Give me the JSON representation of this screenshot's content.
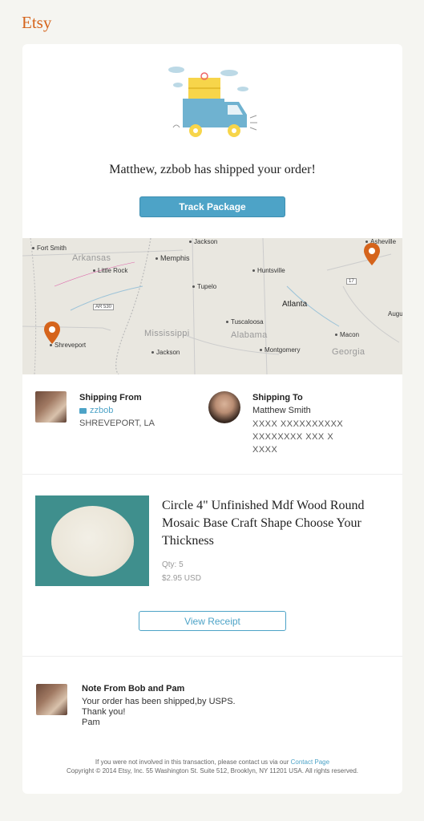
{
  "brand": {
    "logo": "Etsy",
    "accent": "#d5641c",
    "link_color": "#4da3c7"
  },
  "hero": {
    "headline": "Matthew, zzbob has shipped your order!",
    "track_button": "Track Package"
  },
  "map": {
    "cities": [
      {
        "name": "Fort Smith"
      },
      {
        "name": "Jackson"
      },
      {
        "name": "Asheville"
      },
      {
        "name": "Memphis"
      },
      {
        "name": "Little Rock"
      },
      {
        "name": "Huntsville"
      },
      {
        "name": "Tupelo"
      },
      {
        "name": "Atlanta"
      },
      {
        "name": "Tuscaloosa"
      },
      {
        "name": "Macon"
      },
      {
        "name": "Jackson"
      },
      {
        "name": "Montgomery"
      },
      {
        "name": "Shreveport"
      },
      {
        "name": "Augu"
      }
    ],
    "states": [
      "Arkansas",
      "Mississippi",
      "Alabama",
      "Georgia"
    ],
    "highways": [
      "AR 530",
      "17"
    ]
  },
  "shipping_from": {
    "label": "Shipping From",
    "shop": "zzbob",
    "location": "SHREVEPORT, LA",
    "icon": "shop-icon"
  },
  "shipping_to": {
    "label": "Shipping To",
    "name": "Matthew Smith",
    "address_lines": [
      "XXXX XXXXXXXXXX",
      "XXXXXXXX XXX X",
      "XXXX"
    ]
  },
  "product": {
    "title": "Circle 4\" Unfinished Mdf Wood Round Mosaic Base Craft Shape Choose Your Thickness",
    "qty": "Qty: 5",
    "price": "$2.95 USD",
    "receipt_button": "View Receipt"
  },
  "note": {
    "title": "Note From Bob and Pam",
    "lines": [
      "Your order has been shipped,by USPS.",
      "Thank you!",
      "Pam"
    ]
  },
  "footer": {
    "line1_prefix": "If you were not involved in this transaction, please contact us via our ",
    "line1_link": "Contact Page",
    "line2": "Copyright © 2014 Etsy, Inc. 55 Washington St. Suite 512, Brooklyn, NY 11201 USA. All rights reserved."
  }
}
